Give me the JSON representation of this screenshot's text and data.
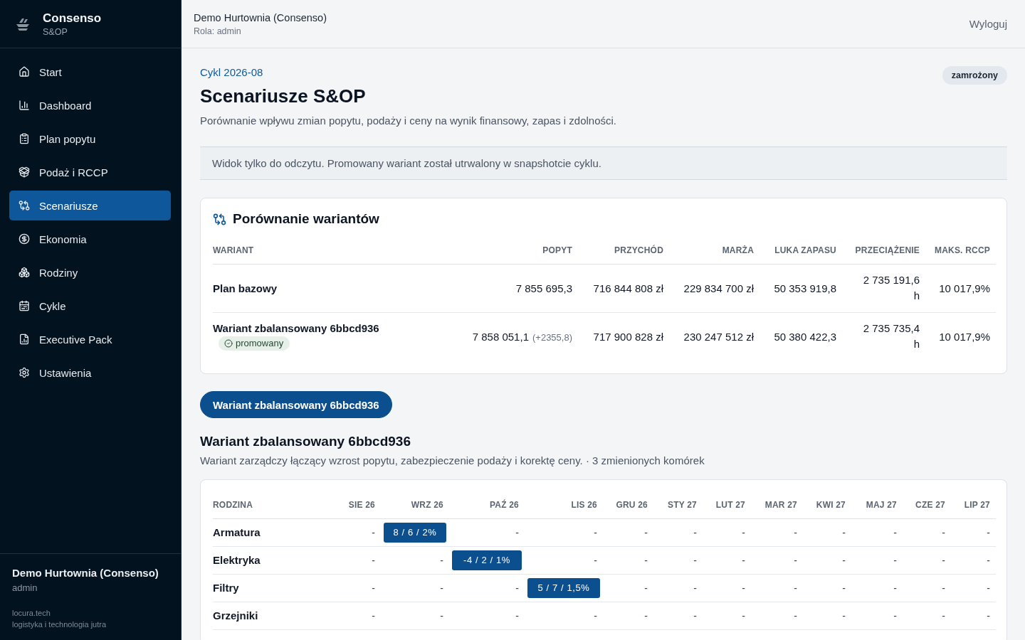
{
  "sidebar": {
    "brand": {
      "name": "Consenso",
      "subtitle": "S&OP"
    },
    "items": [
      {
        "label": "Start",
        "selected": false
      },
      {
        "label": "Dashboard",
        "selected": false
      },
      {
        "label": "Plan popytu",
        "selected": false
      },
      {
        "label": "Podaż i RCCP",
        "selected": false
      },
      {
        "label": "Scenariusze",
        "selected": true
      },
      {
        "label": "Ekonomia",
        "selected": false
      },
      {
        "label": "Rodziny",
        "selected": false
      },
      {
        "label": "Cykle",
        "selected": false
      },
      {
        "label": "Executive Pack",
        "selected": false
      },
      {
        "label": "Ustawienia",
        "selected": false
      }
    ],
    "footer": {
      "org": "Demo Hurtownia (Consenso)",
      "role": "admin",
      "vendor": "locura.tech",
      "tagline": "logistyka i technologia jutra"
    }
  },
  "header": {
    "org": "Demo Hurtownia (Consenso)",
    "role": "Rola: admin",
    "logout": "Wyloguj"
  },
  "page": {
    "cycle": "Cykl 2026-08",
    "status_badge": "zamrożony",
    "title": "Scenariusze S&OP",
    "subtitle": "Porównanie wpływu zmian popytu, podaży i ceny na wynik finansowy, zapas i zdolności.",
    "notice": "Widok tylko do odczytu. Promowany wariant został utrwalony w snapshotcie cyklu."
  },
  "comparison": {
    "title": "Porównanie wariantów",
    "columns": [
      "WARIANT",
      "POPYT",
      "PRZYCHÓD",
      "MARŻA",
      "LUKA ZAPASU",
      "PRZECIĄŻENIE",
      "MAKS. RCCP"
    ],
    "rows": [
      {
        "variant": "Plan bazowy",
        "demand": "7 855 695,3",
        "revenue": "716 844 808 zł",
        "margin": "229 834 700 zł",
        "stock_gap": "50 353 919,8",
        "overload": "2 735 191,6 h",
        "max_rccp": "10 017,9%"
      },
      {
        "variant": "Wariant zbalansowany 6bbcd936",
        "badge": "promowany",
        "demand": "7 858 051,1",
        "demand_delta": "(+2355,8)",
        "revenue": "717 900 828 zł",
        "margin": "230 247 512 zł",
        "stock_gap": "50 380 422,3",
        "overload": "2 735 735,4 h",
        "max_rccp": "10 017,9%"
      }
    ]
  },
  "variant_tabs": [
    {
      "label": "Wariant zbalansowany 6bbcd936",
      "selected": true
    }
  ],
  "variant_detail": {
    "title": "Wariant zbalansowany 6bbcd936",
    "description": "Wariant zarządczy łączący wzrost popytu, zabezpieczenie podaży i korektę ceny. · 3 zmienionych komórek"
  },
  "changes_table": {
    "columns": [
      {
        "label": "RODZINA"
      },
      {
        "label": "SIE 26"
      },
      {
        "label": "WRZ 26"
      },
      {
        "label": "PAŹ 26"
      },
      {
        "label": "LIS 26"
      },
      {
        "label": "GRU 26"
      },
      {
        "label": "STY 27"
      },
      {
        "label": "LUT 27"
      },
      {
        "label": "MAR 27"
      },
      {
        "label": "KWI 27"
      },
      {
        "label": "MAJ 27"
      },
      {
        "label": "CZE 27"
      },
      {
        "label": "LIP 27"
      }
    ],
    "rows": [
      {
        "cells": [
          {
            "text": "Armatura",
            "kind": "family"
          },
          {
            "text": "-",
            "kind": "value",
            "changed": false
          },
          {
            "text": "8 / 6 / 2%",
            "kind": "value",
            "changed": true
          },
          {
            "text": "-",
            "kind": "value",
            "changed": false
          },
          {
            "text": "-",
            "kind": "value",
            "changed": false
          },
          {
            "text": "-",
            "kind": "value",
            "changed": false
          },
          {
            "text": "-",
            "kind": "value",
            "changed": false
          },
          {
            "text": "-",
            "kind": "value",
            "changed": false
          },
          {
            "text": "-",
            "kind": "value",
            "changed": false
          },
          {
            "text": "-",
            "kind": "value",
            "changed": false
          },
          {
            "text": "-",
            "kind": "value",
            "changed": false
          },
          {
            "text": "-",
            "kind": "value",
            "changed": false
          },
          {
            "text": "-",
            "kind": "value",
            "changed": false
          }
        ]
      },
      {
        "cells": [
          {
            "text": "Elektryka",
            "kind": "family"
          },
          {
            "text": "-",
            "kind": "value",
            "changed": false
          },
          {
            "text": "-",
            "kind": "value",
            "changed": false
          },
          {
            "text": "-4 / 2 / 1%",
            "kind": "value",
            "changed": true
          },
          {
            "text": "-",
            "kind": "value",
            "changed": false
          },
          {
            "text": "-",
            "kind": "value",
            "changed": false
          },
          {
            "text": "-",
            "kind": "value",
            "changed": false
          },
          {
            "text": "-",
            "kind": "value",
            "changed": false
          },
          {
            "text": "-",
            "kind": "value",
            "changed": false
          },
          {
            "text": "-",
            "kind": "value",
            "changed": false
          },
          {
            "text": "-",
            "kind": "value",
            "changed": false
          },
          {
            "text": "-",
            "kind": "value",
            "changed": false
          },
          {
            "text": "-",
            "kind": "value",
            "changed": false
          }
        ]
      },
      {
        "cells": [
          {
            "text": "Filtry",
            "kind": "family"
          },
          {
            "text": "-",
            "kind": "value",
            "changed": false
          },
          {
            "text": "-",
            "kind": "value",
            "changed": false
          },
          {
            "text": "-",
            "kind": "value",
            "changed": false
          },
          {
            "text": "5 / 7 / 1,5%",
            "kind": "value",
            "changed": true
          },
          {
            "text": "-",
            "kind": "value",
            "changed": false
          },
          {
            "text": "-",
            "kind": "value",
            "changed": false
          },
          {
            "text": "-",
            "kind": "value",
            "changed": false
          },
          {
            "text": "-",
            "kind": "value",
            "changed": false
          },
          {
            "text": "-",
            "kind": "value",
            "changed": false
          },
          {
            "text": "-",
            "kind": "value",
            "changed": false
          },
          {
            "text": "-",
            "kind": "value",
            "changed": false
          },
          {
            "text": "-",
            "kind": "value",
            "changed": false
          }
        ]
      },
      {
        "cells": [
          {
            "text": "Grzejniki",
            "kind": "family"
          },
          {
            "text": "-",
            "kind": "value",
            "changed": false
          },
          {
            "text": "-",
            "kind": "value",
            "changed": false
          },
          {
            "text": "-",
            "kind": "value",
            "changed": false
          },
          {
            "text": "-",
            "kind": "value",
            "changed": false
          },
          {
            "text": "-",
            "kind": "value",
            "changed": false
          },
          {
            "text": "-",
            "kind": "value",
            "changed": false
          },
          {
            "text": "-",
            "kind": "value",
            "changed": false
          },
          {
            "text": "-",
            "kind": "value",
            "changed": false
          },
          {
            "text": "-",
            "kind": "value",
            "changed": false
          },
          {
            "text": "-",
            "kind": "value",
            "changed": false
          },
          {
            "text": "-",
            "kind": "value",
            "changed": false
          },
          {
            "text": "-",
            "kind": "value",
            "changed": false
          }
        ]
      }
    ]
  }
}
